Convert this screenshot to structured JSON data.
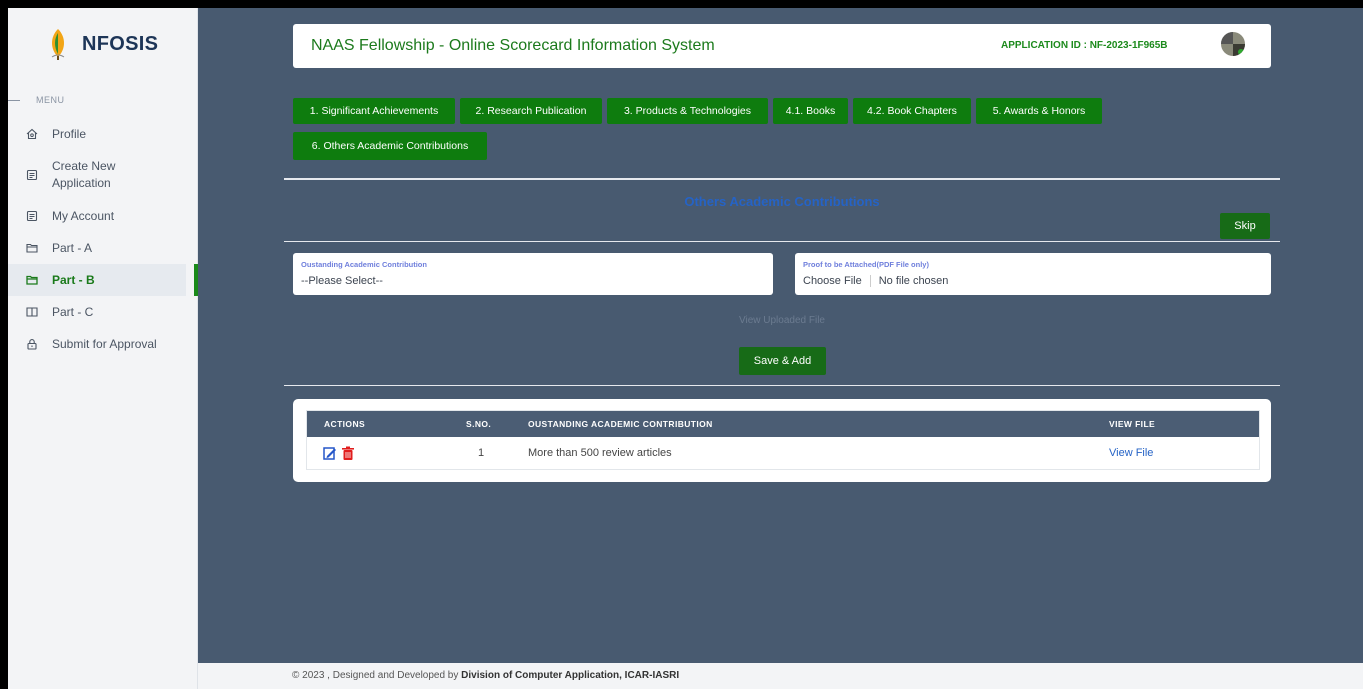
{
  "brand": {
    "name": "NFOSIS"
  },
  "menu_label": "MENU",
  "sidebar": {
    "items": [
      {
        "label": "Profile",
        "icon": "home-icon"
      },
      {
        "label": "Create New Application",
        "icon": "document-icon"
      },
      {
        "label": "My Account",
        "icon": "account-icon"
      },
      {
        "label": "Part - A",
        "icon": "folder-icon"
      },
      {
        "label": "Part - B",
        "icon": "folder-icon",
        "active": true
      },
      {
        "label": "Part - C",
        "icon": "book-icon"
      },
      {
        "label": "Submit for Approval",
        "icon": "lock-icon"
      }
    ]
  },
  "header": {
    "title": "NAAS Fellowship - Online Scorecard Information System",
    "application_id": "APPLICATION ID : NF-2023-1F965B"
  },
  "tabs": [
    "1. Significant Achievements",
    "2. Research Publication",
    "3. Products & Technologies",
    "4.1. Books",
    "4.2. Book Chapters",
    "5. Awards & Honors",
    "6. Others Academic Contributions"
  ],
  "section_title": "Others Academic Contributions",
  "skip_label": "Skip",
  "form": {
    "contribution_label": "Oustanding Academic Contribution",
    "contribution_value": "--Please Select--",
    "proof_label": "Proof to be Attached(PDF File only)",
    "choose_file": "Choose File",
    "no_file": "No file chosen",
    "view_uploaded": "View Uploaded File",
    "save_label": "Save & Add"
  },
  "table": {
    "headers": [
      "ACTIONS",
      "S.NO.",
      "OUSTANDING ACADEMIC CONTRIBUTION",
      "VIEW FILE"
    ],
    "rows": [
      {
        "sno": "1",
        "contribution": "More than 500 review articles",
        "view": "View File"
      }
    ]
  },
  "footer": {
    "prefix": "© 2023 , Designed and Developed by ",
    "org": "Division of Computer Application, ICAR-IASRI"
  },
  "colors": {
    "primary_green": "#0e7c0e",
    "content_bg": "#485a70",
    "link_blue": "#2563c6"
  }
}
